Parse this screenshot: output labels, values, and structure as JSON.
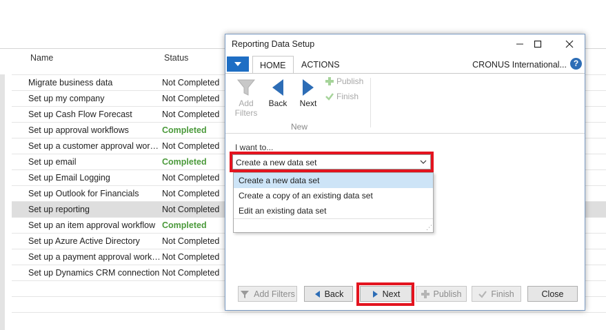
{
  "list": {
    "columns": {
      "name": "Name",
      "status": "Status"
    },
    "rows": [
      {
        "name": "Migrate business data",
        "status": "Not Completed"
      },
      {
        "name": "Set up my company",
        "status": "Not Completed"
      },
      {
        "name": "Set up Cash Flow Forecast",
        "status": "Not Completed"
      },
      {
        "name": "Set up approval workflows",
        "status": "Completed"
      },
      {
        "name": "Set up a customer approval workf...",
        "status": "Not Completed"
      },
      {
        "name": "Set up email",
        "status": "Completed"
      },
      {
        "name": "Set up Email Logging",
        "status": "Not Completed"
      },
      {
        "name": "Set up Outlook for Financials",
        "status": "Not Completed"
      },
      {
        "name": "Set up reporting",
        "status": "Not Completed"
      },
      {
        "name": "Set up an item approval workflow",
        "status": "Completed"
      },
      {
        "name": "Set up Azure Active Directory",
        "status": "Not Completed"
      },
      {
        "name": "Set up a payment approval workfl...",
        "status": "Not Completed"
      },
      {
        "name": "Set up Dynamics CRM connection",
        "status": "Not Completed"
      }
    ]
  },
  "dialog": {
    "title": "Reporting Data Setup",
    "tabs": {
      "home": "HOME",
      "actions": "ACTIONS"
    },
    "company": "CRONUS International...",
    "help_glyph": "?",
    "ribbon": {
      "add_filters_line1": "Add",
      "add_filters_line2": "Filters",
      "back": "Back",
      "next": "Next",
      "publish": "Publish",
      "finish": "Finish",
      "group_label": "New"
    },
    "want_label": "I want to...",
    "selected_option": "Create a new data set",
    "options": [
      "Create a new data set",
      "Create a copy of an existing data set",
      "Edit an existing data set"
    ],
    "footer": {
      "add_filters": "Add Filters",
      "back": "Back",
      "next": "Next",
      "publish": "Publish",
      "finish": "Finish",
      "close": "Close"
    }
  },
  "colors": {
    "completed": "#4b9a3b",
    "accent": "#1e6ec4",
    "highlight": "#e3141f"
  }
}
